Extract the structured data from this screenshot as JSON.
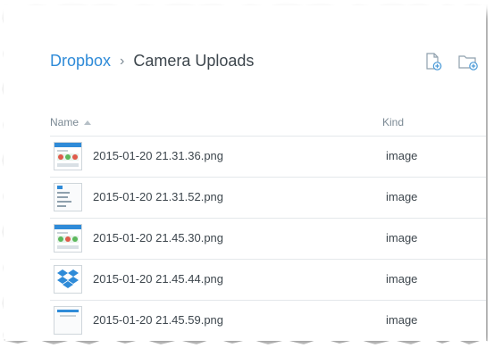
{
  "breadcrumb": {
    "root": "Dropbox",
    "separator": "›",
    "current": "Camera Uploads"
  },
  "actions": {
    "new_file_icon": "new-file-icon",
    "new_folder_icon": "new-folder-icon"
  },
  "columns": {
    "name": "Name",
    "kind": "Kind"
  },
  "files": [
    {
      "name": "2015-01-20 21.31.36.png",
      "kind": "image",
      "thumb": "app-screenshot"
    },
    {
      "name": "2015-01-20 21.31.52.png",
      "kind": "image",
      "thumb": "menu-screenshot"
    },
    {
      "name": "2015-01-20 21.45.30.png",
      "kind": "image",
      "thumb": "app-screenshot"
    },
    {
      "name": "2015-01-20 21.45.44.png",
      "kind": "image",
      "thumb": "dropbox-logo"
    },
    {
      "name": "2015-01-20 21.45.59.png",
      "kind": "image",
      "thumb": "blank-screenshot"
    }
  ],
  "colors": {
    "link": "#2f8bd8",
    "text": "#3d464d",
    "muted": "#7b8994",
    "divider": "#e4e8eb"
  }
}
